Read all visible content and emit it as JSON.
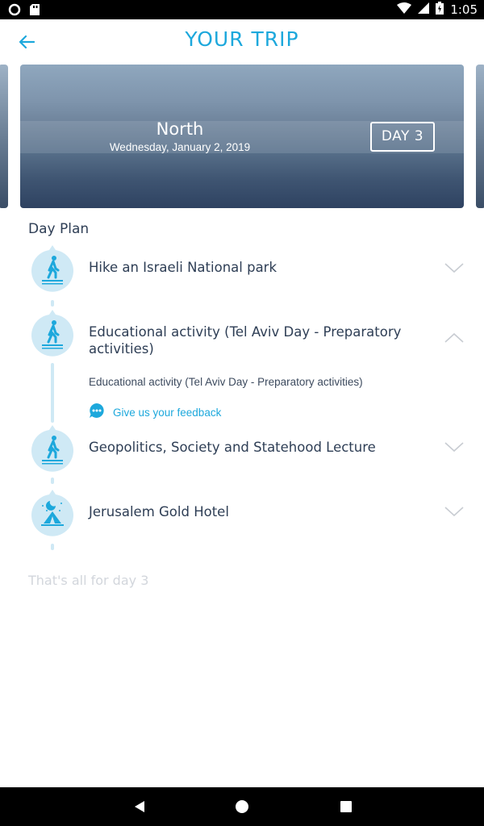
{
  "status_bar": {
    "time": "1:05"
  },
  "header": {
    "title": "YOUR TRIP"
  },
  "day_card": {
    "region": "North",
    "date": "Wednesday, January 2, 2019",
    "badge": "DAY 3"
  },
  "day_plan": {
    "heading": "Day Plan",
    "items": [
      {
        "title": "Hike an Israeli National park",
        "icon": "hiker-icon",
        "expanded": false
      },
      {
        "title": "Educational activity (Tel Aviv Day - Preparatory activities)",
        "icon": "hiker-icon",
        "expanded": true,
        "detail": "Educational activity (Tel Aviv Day - Preparatory activities)",
        "feedback_label": "Give us your feedback"
      },
      {
        "title": "Geopolitics, Society and Statehood Lecture",
        "icon": "hiker-icon",
        "expanded": false
      },
      {
        "title": "Jerusalem Gold Hotel",
        "icon": "tent-night-icon",
        "expanded": false
      }
    ],
    "end_note": "That's all for day 3"
  },
  "colors": {
    "accent": "#1da8dc",
    "text": "#2e3e55",
    "timeline": "#cfe9f5"
  }
}
